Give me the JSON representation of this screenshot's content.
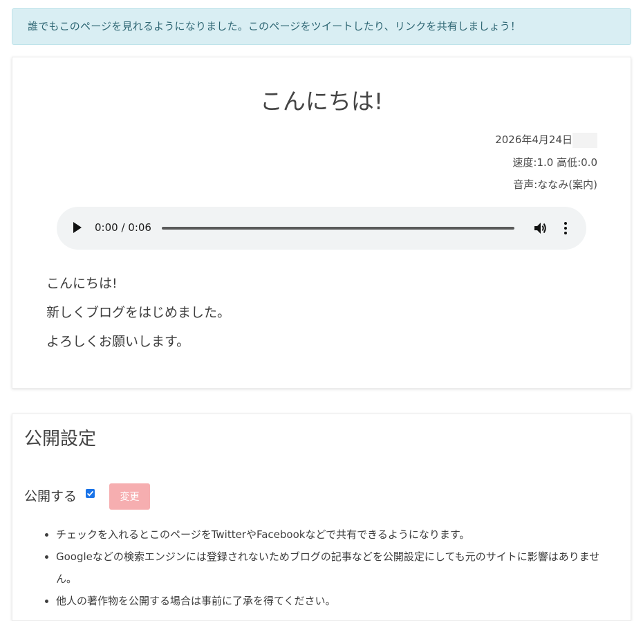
{
  "alert": {
    "text": "誰でもこのページを見れるようになりました。このページをツイートしたり、リンクを共有しましょう！"
  },
  "post": {
    "title": "こんにちは!",
    "date": "2026年4月24日",
    "speed": "速度:1.0 高低:0.0",
    "voice": "音声:ななみ(案内)",
    "audio": {
      "time": "0:00 / 0:06",
      "progress": 0
    },
    "body": [
      "こんにちは!",
      "新しくブログをはじめました。",
      "よろしくお願いします。"
    ]
  },
  "settings": {
    "title": "公開設定",
    "publish_label": "公開する",
    "publish_checked": true,
    "change_label": "変更",
    "notes": [
      "チェックを入れるとこのページをTwitterやFacebookなどで共有できるようになります。",
      "Googleなどの検索エンジンには登録されないためブログの記事などを公開設定にしても元のサイトに影響はありません。",
      "他人の著作物を公開する場合は事前に了承を得てください。"
    ]
  },
  "colors": {
    "alert_bg": "#d9eef3",
    "alert_text": "#2e6673",
    "button_bg": "#f6aeb0",
    "checkbox": "#1a73e8"
  }
}
